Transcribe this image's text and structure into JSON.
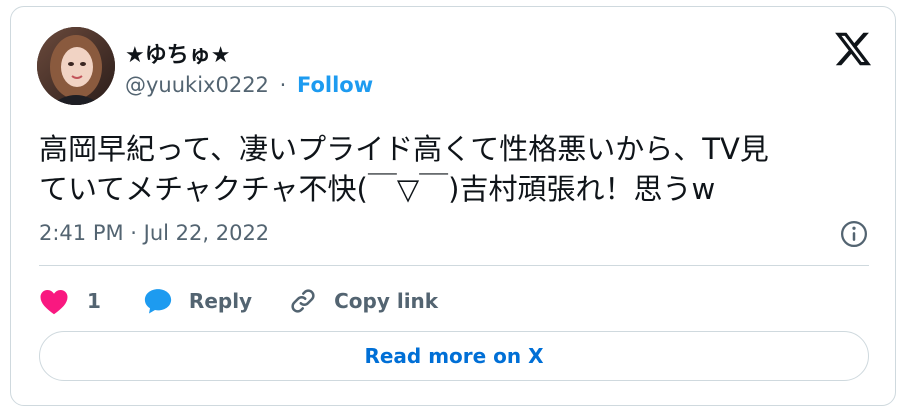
{
  "author": {
    "display_name": "★ゆちゅ★",
    "handle": "@yuukix0222",
    "separator": "·",
    "follow_label": "Follow"
  },
  "tweet": {
    "text_line1": "高岡早紀って、凄いプライド高くて性格悪いから、TV見",
    "text_line2": "ていてメチャクチャ不快(￣▽￣)吉村頑張れ！思うw",
    "timestamp": "2:41 PM · Jul 22, 2022"
  },
  "actions": {
    "like_count": "1",
    "reply_label": "Reply",
    "copy_link_label": "Copy link"
  },
  "read_more_label": "Read more on X",
  "colors": {
    "accent": "#1d9bf0",
    "link": "#006fd6",
    "like": "#f91880",
    "text": "#0f1419",
    "muted": "#536471",
    "border": "#cfd9de"
  },
  "icons": [
    "x-logo-icon",
    "info-icon",
    "heart-icon",
    "reply-bubble-icon",
    "link-icon"
  ]
}
